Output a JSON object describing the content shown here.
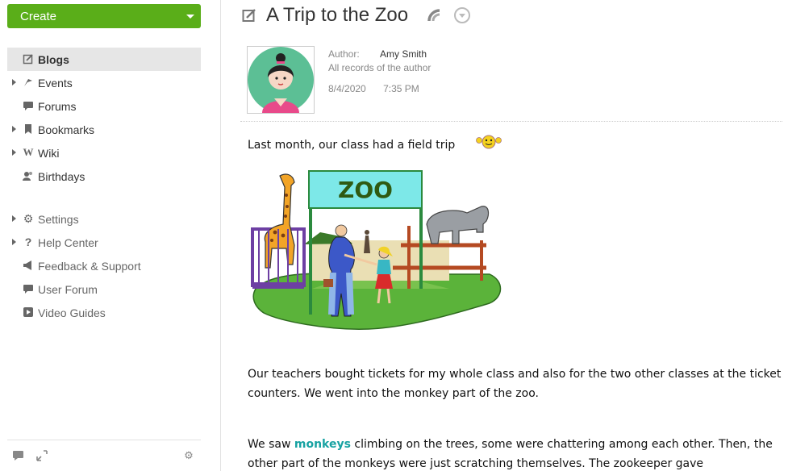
{
  "sidebar": {
    "create_label": "Create",
    "items": [
      {
        "label": "Blogs",
        "icon": "blog-icon"
      },
      {
        "label": "Events",
        "icon": "events-icon"
      },
      {
        "label": "Forums",
        "icon": "forums-icon"
      },
      {
        "label": "Bookmarks",
        "icon": "bookmark-icon"
      },
      {
        "label": "Wiki",
        "icon": "wiki-icon"
      },
      {
        "label": "Birthdays",
        "icon": "birthdays-icon"
      }
    ],
    "secondary": [
      {
        "label": "Settings",
        "icon": "gear-icon"
      },
      {
        "label": "Help Center",
        "icon": "question-icon"
      },
      {
        "label": "Feedback & Support",
        "icon": "megaphone-icon"
      },
      {
        "label": "User Forum",
        "icon": "chat-icon"
      },
      {
        "label": "Video Guides",
        "icon": "play-icon"
      }
    ]
  },
  "post": {
    "title": "A Trip to the Zoo",
    "author_label": "Author:",
    "author_name": "Amy Smith",
    "all_records": "All records of the author",
    "date": "8/4/2020",
    "time": "7:35 PM",
    "p1": "Last month, our class had a field trip",
    "zoo_sign": "ZOO",
    "p2": "Our teachers bought tickets for my whole class and also for the two other classes at the ticket counters. We went into the monkey part of the zoo.",
    "p3_before": "We saw",
    "p3_highlight": "monkeys",
    "p3_after": "climbing on the trees, some were chattering among each other. Then, the other part of the monkeys were just scratching themselves. The zookeeper gave"
  },
  "colors": {
    "accent": "#5aae19",
    "highlight": "#17a2a2"
  }
}
